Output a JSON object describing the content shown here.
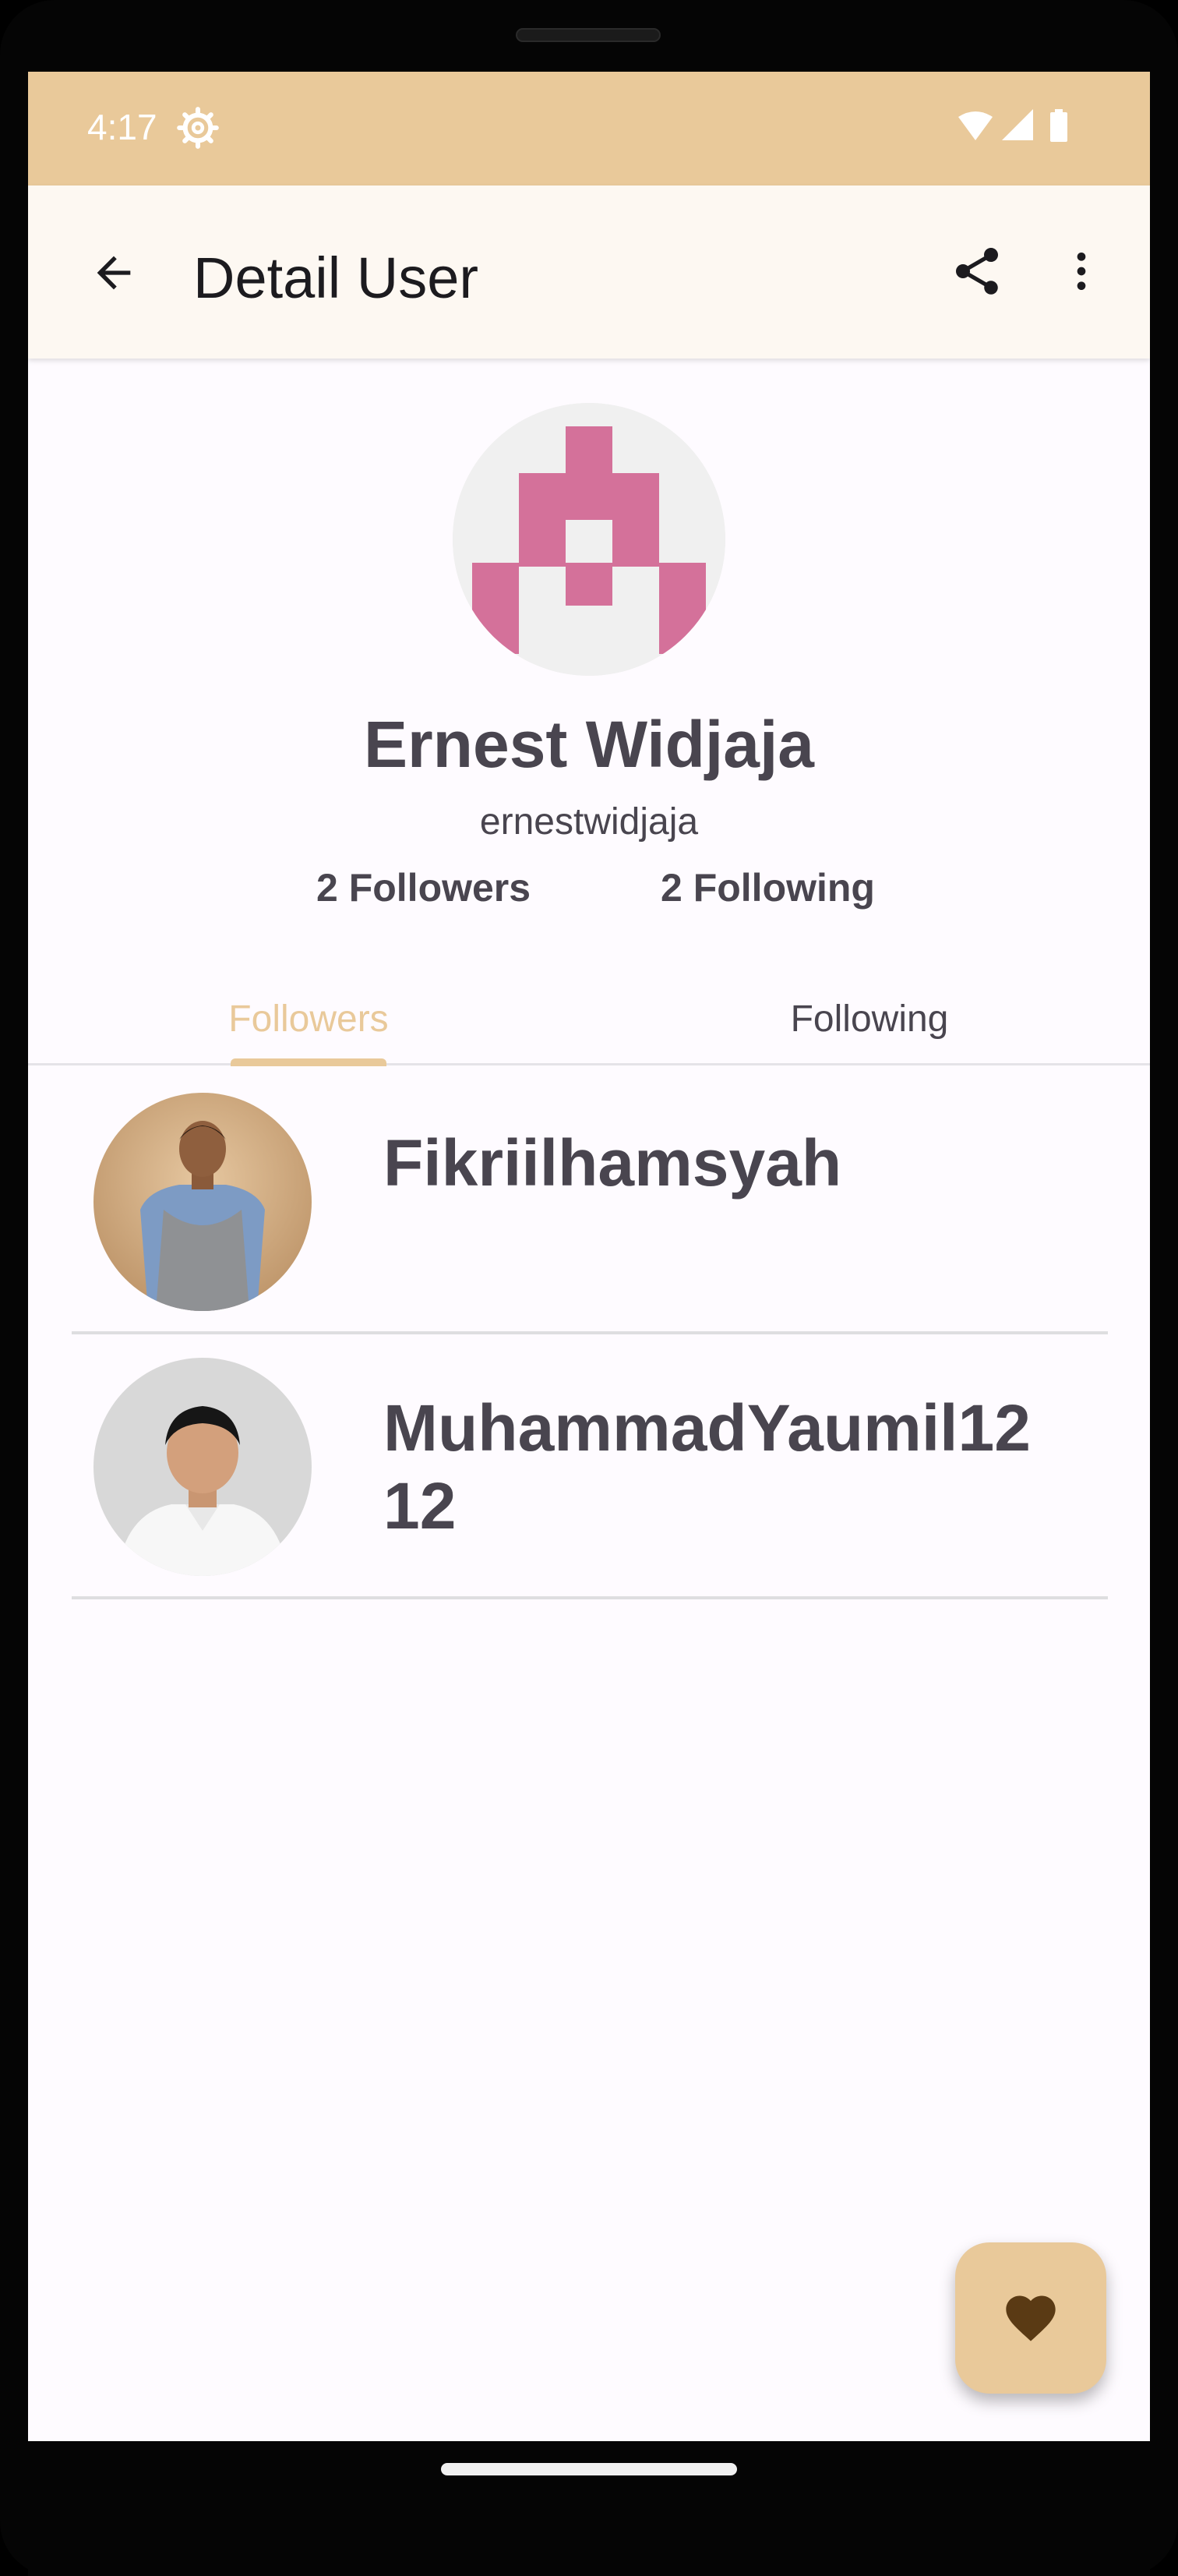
{
  "status_bar": {
    "time": "4:17",
    "settings_icon": "gear-icon",
    "icons": [
      "wifi-icon",
      "signal-icon",
      "battery-icon"
    ]
  },
  "app_bar": {
    "title": "Detail User",
    "back_icon": "arrow-back-icon",
    "share_icon": "share-icon",
    "more_icon": "more-vert-icon"
  },
  "profile": {
    "name": "Ernest Widjaja",
    "username": "ernestwidjaja",
    "followers": "2 Followers",
    "following": "2 Following",
    "avatar_color": "#d4719a"
  },
  "tabs": [
    {
      "label": "Followers",
      "selected": true
    },
    {
      "label": "Following",
      "selected": false
    }
  ],
  "list": [
    {
      "name": "Fikriilhamsyah"
    },
    {
      "name": "MuhammadYaumil1212"
    }
  ],
  "fab": {
    "icon": "heart-icon",
    "color": "#e9c99a"
  },
  "colors": {
    "accent": "#e9c99a",
    "text": "#49454f",
    "background": "#fefbff"
  }
}
